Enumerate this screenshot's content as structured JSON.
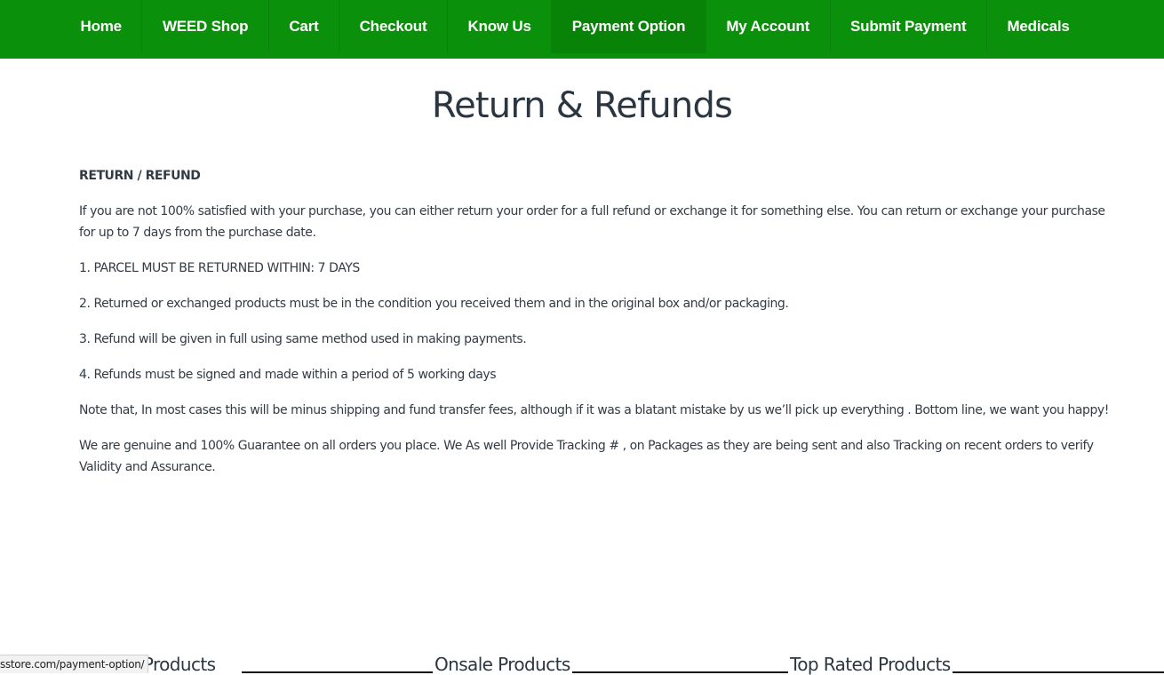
{
  "nav": {
    "items": [
      {
        "label": "Home",
        "active": false
      },
      {
        "label": "WEED Shop",
        "active": false
      },
      {
        "label": "Cart",
        "active": false
      },
      {
        "label": "Checkout",
        "active": false
      },
      {
        "label": "Know Us",
        "active": false
      },
      {
        "label": "Payment Option",
        "active": true
      },
      {
        "label": "My Account",
        "active": false
      },
      {
        "label": "Submit Payment",
        "active": false
      },
      {
        "label": "Medicals",
        "active": false
      }
    ]
  },
  "colors": {
    "nav_bg": "#0a900a",
    "nav_active_bg": "#088308",
    "nav_text": "#ffffff",
    "title_text": "#2b3640"
  },
  "page": {
    "title": "Return & Refunds",
    "section_heading": "RETURN / REFUND",
    "paragraphs": [
      "If you are not 100% satisfied with your purchase, you can either return your order for a full refund or exchange it for something else. You can return or exchange your purchase for up to 7 days from the purchase date.",
      "1. PARCEL MUST BE RETURNED WITHIN: 7 DAYS",
      "2. Returned or exchanged products must be in the condition you received them and in the original box and/or packaging.",
      "3. Refund will be given in full using same method used in making payments.",
      "4. Refunds must be signed and made within a period of 5 working days",
      "Note that, In most cases this will be minus shipping and fund transfer fees, although if it was a blatant mistake by us we’ll pick up everything . Bottom line, we want you happy!",
      "We are genuine and 100% Guarantee on all orders you place. We As well Provide Tracking # , on Packages as they are being sent and also Tracking on recent orders to verify Validity and Assurance."
    ]
  },
  "products": {
    "headings": [
      "d Products",
      "Onsale Products",
      "Top Rated Products"
    ]
  },
  "status_bar": {
    "url": "sstore.com/payment-option/"
  }
}
